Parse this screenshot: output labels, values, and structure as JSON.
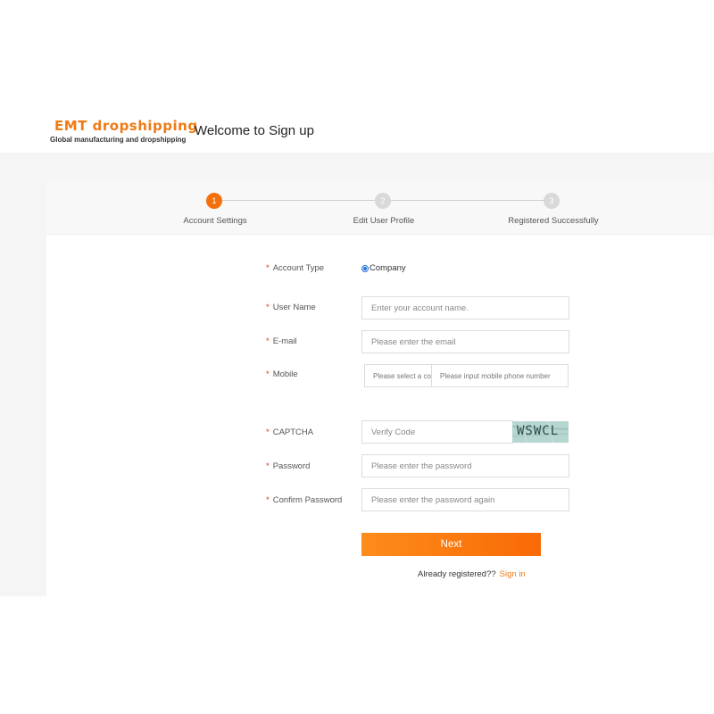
{
  "header": {
    "logo_title": "EMT dropshipping",
    "logo_subtitle": "Global manufacturing and dropshipping",
    "welcome": "Welcome to Sign up"
  },
  "steps": [
    {
      "number": "1",
      "label": "Account Settings",
      "active": true
    },
    {
      "number": "2",
      "label": "Edit User Profile",
      "active": false
    },
    {
      "number": "3",
      "label": "Registered Successfully",
      "active": false
    }
  ],
  "form": {
    "required_mark": "*",
    "account_type": {
      "label": "Account Type",
      "option": "Company",
      "selected": true
    },
    "username": {
      "label": "User Name",
      "placeholder": "Enter your account name."
    },
    "email": {
      "label": "E-mail",
      "placeholder": "Please enter the email"
    },
    "mobile": {
      "label": "Mobile",
      "code_placeholder": "Please select a co",
      "number_placeholder": "Please input mobile phone number"
    },
    "captcha": {
      "label": "CAPTCHA",
      "placeholder": "Verify Code",
      "image_text": "WSWCL"
    },
    "password": {
      "label": "Password",
      "placeholder": "Please enter the password"
    },
    "confirm_password": {
      "label": "Confirm Password",
      "placeholder": "Please enter the password again"
    },
    "next_button": "Next",
    "already_registered": "Already registered??",
    "sign_in": "Sign in"
  },
  "colors": {
    "brand_orange": "#f5700a",
    "required_red": "#e0301e",
    "radio_blue": "#1e6fd9",
    "inactive_step": "#d9d9d9"
  }
}
